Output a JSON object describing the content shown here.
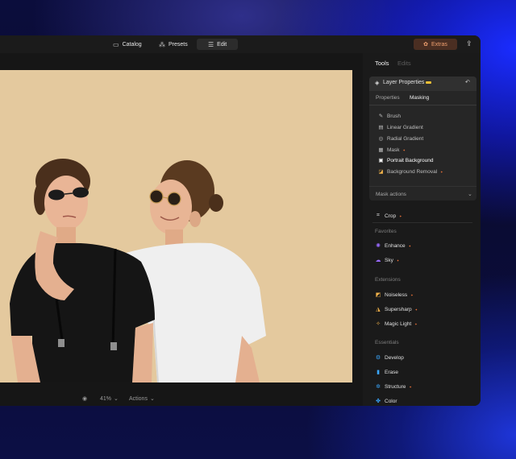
{
  "topbar": {
    "catalog": "Catalog",
    "presets": "Presets",
    "edit": "Edit",
    "extras": "Extras"
  },
  "bottombar": {
    "zoom": "41%",
    "actions": "Actions"
  },
  "panel": {
    "tabs": [
      "Tools",
      "Edits"
    ],
    "layer_properties": "Layer Properties",
    "subtabs": [
      "Properties",
      "Masking"
    ],
    "mask_items": [
      "Brush",
      "Linear Gradient",
      "Radial Gradient",
      "Mask",
      "Portrait Background",
      "Background Removal"
    ],
    "mask_actions": "Mask actions",
    "crop": "Crop",
    "sections": {
      "favorites": "Favorites",
      "extensions": "Extensions",
      "essentials": "Essentials"
    },
    "favorites": [
      "Enhance",
      "Sky"
    ],
    "extensions": [
      "Noiseless",
      "Supersharp",
      "Magic Light"
    ],
    "essentials": [
      "Develop",
      "Erase",
      "Structure",
      "Color"
    ]
  },
  "colors": {
    "accent_orange": "#ff7a3c",
    "extras_bg": "#4a2e22",
    "panel_bg": "#1a1a1a",
    "canvas_bg": "#e4c99e"
  },
  "icons": {
    "catalog": "folder-icon",
    "presets": "presets-icon",
    "edit": "sliders-icon",
    "extras": "extras-icon",
    "share": "share-icon",
    "eye": "eye-icon",
    "undo": "undo-icon"
  }
}
